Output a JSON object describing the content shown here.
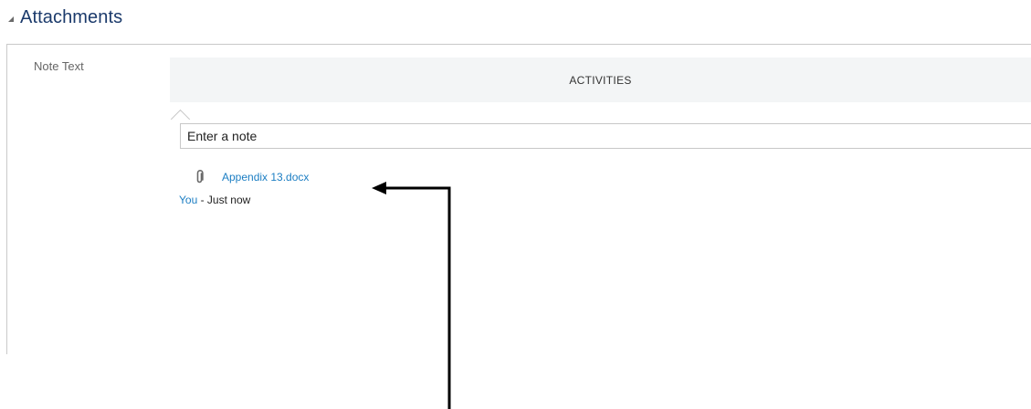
{
  "section": {
    "title": "Attachments",
    "collapse_icon": "triangle-collapse-icon"
  },
  "field": {
    "label": "Note Text"
  },
  "activities": {
    "tab_label": "ACTIVITIES"
  },
  "note_input": {
    "value": "",
    "placeholder": "Enter a note"
  },
  "attachment": {
    "icon": "paperclip-icon",
    "file_name": "Appendix 13.docx",
    "author": "You",
    "separator": " - ",
    "time": "Just now"
  },
  "colors": {
    "header_text": "#1b3a6b",
    "link": "#1c7ec3",
    "activities_bg": "#f3f5f6",
    "divider": "#c9c9c9",
    "annotation_arrow": "#000000"
  }
}
